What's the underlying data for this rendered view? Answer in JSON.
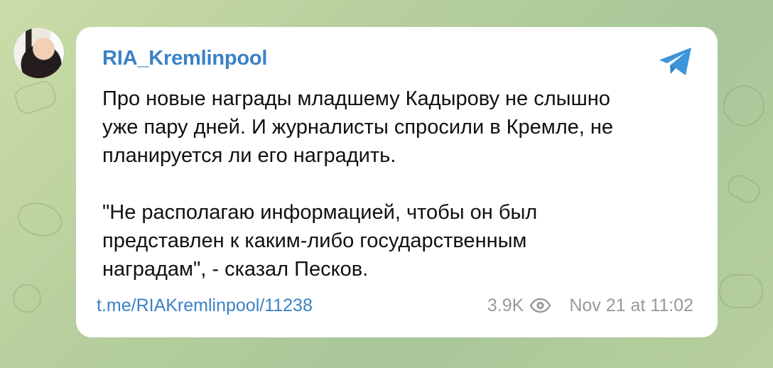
{
  "channel": {
    "name": "RIA_Kremlinpool"
  },
  "message": {
    "text": "Про новые награды младшему Кадырову не слышно\nуже пару дней. И журналисты спросили в Кремле, не\nпланируется ли его наградить.\n\n\"Не располагаю информацией, чтобы он был\nпредставлен к каким-либо государственным\nнаградам\", - сказал Песков.",
    "link": "t.me/RIAKremlinpool/11238",
    "views": "3.9K",
    "time": "Nov 21 at 11:02"
  },
  "icons": {
    "telegram": "telegram-icon",
    "views": "eye-icon"
  },
  "colors": {
    "accent": "#3b82c4",
    "telegram_blue": "#3d95db",
    "background": "#b9cf9f",
    "card": "#ffffff",
    "meta": "#9a9a9a"
  }
}
